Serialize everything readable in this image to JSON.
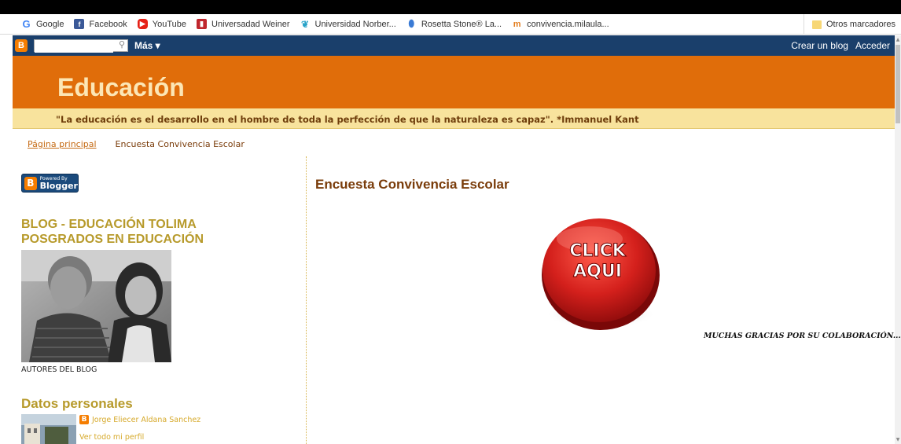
{
  "bookmarks": {
    "items": [
      {
        "label": "Google",
        "icon": "google-icon"
      },
      {
        "label": "Facebook",
        "icon": "facebook-icon"
      },
      {
        "label": "YouTube",
        "icon": "youtube-icon"
      },
      {
        "label": "Universadad Weiner",
        "icon": "bookmark-icon"
      },
      {
        "label": "Universidad Norber...",
        "icon": "book-icon"
      },
      {
        "label": "Rosetta Stone® La...",
        "icon": "rosetta-icon"
      },
      {
        "label": "convivencia.milaula...",
        "icon": "milaula-icon"
      }
    ],
    "other": "Otros marcadores"
  },
  "navbar": {
    "search_placeholder": "",
    "more_label": "Más ▾",
    "create_blog": "Crear un blog",
    "sign_in": "Acceder"
  },
  "header": {
    "title": "Educación",
    "description": "\"La educación es el desarrollo en el hombre de toda la perfección de que la naturaleza es capaz\". *Immanuel Kant"
  },
  "tabs": {
    "home": "Página principal",
    "current": "Encuesta Convivencia Escolar"
  },
  "sidebar": {
    "powered_small": "Powered By",
    "powered_large": "Blogger",
    "blog_title": "BLOG - EDUCACIÓN TOLIMA POSGRADOS EN EDUCACIÓN",
    "photo_caption": "AUTORES DEL BLOG",
    "datos_title": "Datos personales",
    "profile_name": "Jorge Eliecer Aldana Sanchez",
    "profile_link": "Ver todo mi perfil"
  },
  "post": {
    "title": "Encuesta Convivencia Escolar",
    "button_line1": "CLICK",
    "button_line2": "AQUI",
    "thanks": "MUCHAS GRACIAS POR SU COLABORACIÓN..."
  },
  "colors": {
    "header_bg": "#e06d0a",
    "title_text": "#fce6b5",
    "desc_bg": "#f8e39d",
    "navbar_bg": "#1a3f6b",
    "sidebar_heading": "#b79a2b",
    "button_red": "#d42a2a"
  }
}
